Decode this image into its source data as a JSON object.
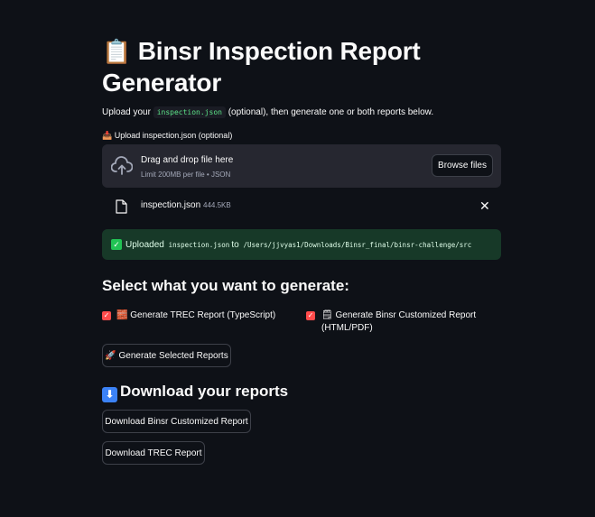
{
  "header": {
    "title_emoji": "📋",
    "title": "Binsr Inspection Report Generator"
  },
  "intro": {
    "before": "Upload your ",
    "code": "inspection.json",
    "after": " (optional), then generate one or both reports below."
  },
  "uploader": {
    "label_emoji": "📥",
    "label": "Upload inspection.json (optional)",
    "drop_title": "Drag and drop file here",
    "drop_limit": "Limit 200MB per file • JSON",
    "browse_label": "Browse files",
    "file": {
      "name": "inspection.json",
      "size": "444.5KB"
    }
  },
  "success": {
    "prefix": "Uploaded ",
    "file": "inspection.json",
    "middle": " to ",
    "path": "/Users/jjvyas1/Downloads/Binsr_final/binsr-challenge/src"
  },
  "select_section": {
    "heading": "Select what you want to generate:",
    "options": [
      {
        "emoji": "🧱",
        "label": "Generate TREC Report (TypeScript)",
        "checked": true
      },
      {
        "emoji": "🗒",
        "label_line1": "Generate Binsr Customized Report",
        "label_line2": "(HTML/PDF)",
        "checked": true
      }
    ],
    "generate_emoji": "🚀",
    "generate_label": "Generate Selected Reports"
  },
  "download_section": {
    "heading_icon": "⬇",
    "heading": "Download your reports",
    "buttons": [
      "Download Binsr Customized Report",
      "Download TREC Report"
    ]
  },
  "colors": {
    "background": "#0e1117",
    "surface": "#262730",
    "success_bg": "#173928",
    "checkbox": "#ff4b4b",
    "code": "#5ce488"
  }
}
